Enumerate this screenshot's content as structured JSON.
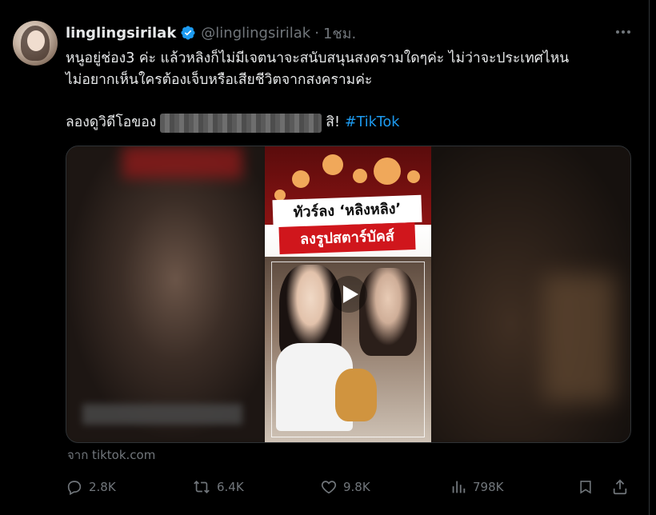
{
  "tweet": {
    "display_name": "linglingsirilak",
    "handle": "@linglingsirilak",
    "separator": "·",
    "time": "1ชม.",
    "text_line1": "หนูอยู่ช่อง3 ค่ะ แล้วหลิงก็ไม่มีเจตนาจะสนับสนุนสงครามใดๆค่ะ ไม่ว่าจะประเทศไหน",
    "text_line2": "ไม่อยากเห็นใครต้องเจ็บหรือเสียชีวิตจากสงครามค่ะ",
    "link_prefix": "ลองดูวิดีโอของ",
    "link_suffix": "สิ!",
    "hashtag": "#TikTok",
    "source": "จาก tiktok.com"
  },
  "video": {
    "headline1": "ทัวร์ลง ‘หลิงหลิง’",
    "headline2": "ลงรูปสตาร์บัคส์"
  },
  "actions": {
    "replies": "2.8K",
    "retweets": "6.4K",
    "likes": "9.8K",
    "views": "798K"
  },
  "icons": {
    "verified": "verified-badge-icon",
    "more": "more-icon",
    "reply": "reply-icon",
    "retweet": "retweet-icon",
    "like": "heart-icon",
    "views": "views-icon",
    "bookmark": "bookmark-icon",
    "share": "share-icon",
    "play": "play-icon"
  },
  "colors": {
    "background": "#000000",
    "text": "#e7e9ea",
    "muted": "#71767b",
    "accent": "#1d9bf0"
  }
}
